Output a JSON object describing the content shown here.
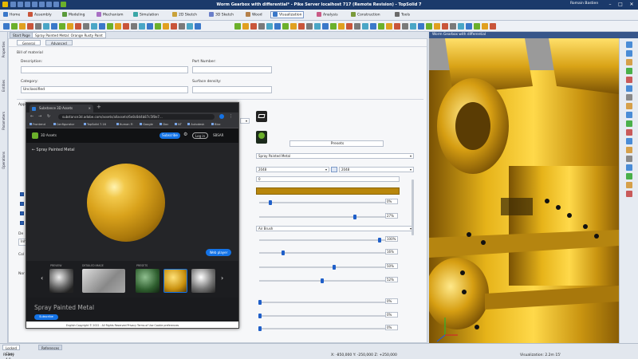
{
  "window": {
    "title": "Worm Gearbox with differential* - Pike Server localhost 717 (Remote Revision) - TopSolid 7",
    "user": "Romain Bastien",
    "controls": [
      "–",
      "□",
      "✕"
    ]
  },
  "ribbon": {
    "tabs": [
      "Home",
      "Assembly",
      "Modeling",
      "Mechanism",
      "Simulation",
      "2D Sketch",
      "3D Sketch",
      "Wood",
      "Visualization",
      "Analysis",
      "Construction",
      "Tools"
    ],
    "selected_index": 8,
    "colors": [
      "#3a78c9",
      "#c9553a",
      "#5a9a3a",
      "#a86fc4",
      "#3aa6a6",
      "#c9a23a",
      "#6a7fc9",
      "#b4804a",
      "#3a78c9",
      "#c95a86",
      "#7a9a3a",
      "#6a6a6a"
    ]
  },
  "doc_tabs": {
    "items": [
      "Start Page",
      "Spray Painted Metal: Orange Rusty Paint"
    ],
    "selected_index": 1,
    "viewport_tab": "Worm Gearbox with differential"
  },
  "left_strip": [
    "Properties",
    "Entities",
    "Parameters",
    "Operations"
  ],
  "panel": {
    "subtabs": [
      "General",
      "Advanced"
    ],
    "bill_of_material": "Bill of material",
    "description_label": "Description:",
    "part_number_label": "Part Number:",
    "category_label": "Category:",
    "category_value": "Unclassified",
    "surface_density_label": "Surface density:",
    "appearance_label": "Appearance",
    "presets_button": "Presets",
    "material_dropdown": "Spray Painted Metal",
    "res_left": "2048",
    "res_right": "2048",
    "seed_value": "0",
    "color_swatch": "#b8860b",
    "finish_dropdown": "Air Brush",
    "pct_values": [
      "0%",
      "27%",
      "100%",
      "16%",
      "50%",
      "52%",
      "0%",
      "0%",
      "0%"
    ],
    "left_labels": [
      "De",
      "Col",
      "Nor"
    ],
    "left_value": "Inhe"
  },
  "browser": {
    "tab_title": "Substance 3D Assets",
    "url": "substance3d.adobe.com/assets/allassets/6e8c8d4b87c5f8e7...",
    "bookmarks": [
      "Frontend",
      "Configurator",
      "TopSolid 7.16",
      "Human Fi",
      "Google",
      "Doc",
      "NT",
      "Autodesk",
      "Bloc"
    ],
    "product": "3D Assets",
    "subscribe": "Subscribe",
    "login": "Log in",
    "sbsar": "SBSAR",
    "material_header": "Spray Painted Metal",
    "web_player": "Web player",
    "thumb_labels": [
      "PREVIEW",
      "DETAILED IMAGE",
      "PRESETS"
    ],
    "material_title": "Spray Painted Metal",
    "subscribe_small": "Subscribe",
    "footer": "English   Copyright © 2022 - All Rights Reserved   Privacy   Terms of Use   Cookie preferences"
  },
  "status": {
    "tabs": [
      "Locked Class A 0",
      "References"
    ],
    "ready": "Ready",
    "coords": "X: -850,000   Y: -250,000   Z: +250,000",
    "visualization": "Visualization: 2.2m 15'"
  },
  "viewport_icons": [
    "#4a8cd6",
    "#4a8cd6",
    "#d6a04a",
    "#4ab04a",
    "#c95a5a",
    "#4a8cd6",
    "#8a8a8a",
    "#d6a04a",
    "#4a8cd6",
    "#4ab04a",
    "#c95a5a",
    "#4a8cd6",
    "#d6a04a",
    "#8a8a8a",
    "#4a8cd6",
    "#4ab04a",
    "#d6a04a",
    "#c95a5a"
  ]
}
